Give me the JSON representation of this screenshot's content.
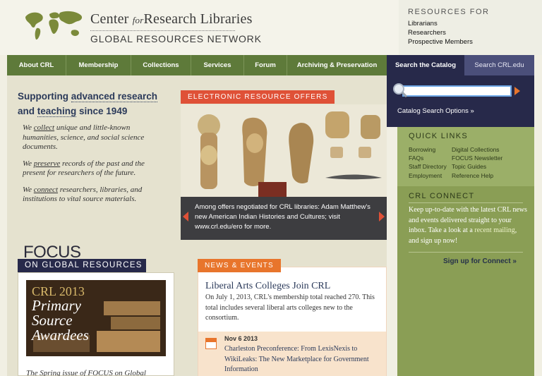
{
  "brand": {
    "name_part1": "Center ",
    "name_for": "for",
    "name_part2": "Research Libraries",
    "network": "GLOBAL RESOURCES NETWORK"
  },
  "resources_for": {
    "title": "RESOURCES FOR",
    "links": [
      "Librarians",
      "Researchers",
      "Prospective Members"
    ]
  },
  "nav": {
    "items": [
      "About CRL",
      "Membership",
      "Collections",
      "Services",
      "Forum",
      "Archiving & Preservation"
    ]
  },
  "catalog": {
    "tab_active": "Search the Catalog",
    "tab_alt": "Search CRL.edu",
    "options_link": "Catalog Search Options »",
    "search_value": ""
  },
  "tagline": {
    "pre": "Supporting ",
    "kw1": "advanced research",
    "mid": "and ",
    "kw2": "teaching",
    "post": " since 1949"
  },
  "statements": [
    {
      "pre": "We ",
      "kw": "collect",
      "post": " unique and little-known humanities, science, and social science documents."
    },
    {
      "pre": "We ",
      "kw": "preserve",
      "post": " records of the past and the present for researchers of the future."
    },
    {
      "pre": "We ",
      "kw": "connect",
      "post": " researchers, libraries, and institutions to vital source materials."
    }
  ],
  "ero": {
    "label": "ELECTRONIC RESOURCE OFFERS",
    "caption": "Among offers negotiated for CRL libraries: Adam Matthew's new American Indian Histories and Cultures; visit www.crl.edu/ero for more."
  },
  "focus": {
    "big": "FOCUS",
    "label": "ON GLOBAL RESOURCES",
    "image_year": "CRL 2013",
    "image_title": "Primary Source Awardees",
    "blurb": "The Spring issue of FOCUS on Global"
  },
  "news": {
    "label": "NEWS & EVENTS",
    "headline": "Liberal Arts Colleges Join CRL",
    "body": "On July 1, 2013, CRL's membership total reached 270. This total includes several liberal arts colleges new to the consortium.",
    "event_date": "Nov 6 2013",
    "event_title": "Charleston Preconference: From LexisNexis to WikiLeaks: The New Marketplace for Government Information"
  },
  "quick_links": {
    "title": "QUICK LINKS",
    "col1": [
      "Borrowing",
      "FAQs",
      "Staff Directory",
      "Employment"
    ],
    "col2": [
      "Digital Collections",
      "FOCUS Newsletter",
      "Topic Guides",
      "Reference Help"
    ]
  },
  "connect": {
    "title": "CRL CONNECT",
    "body_pre": "Keep up-to-date with the latest CRL news and events delivered straight to your inbox. Take a look at a ",
    "body_link": "recent mailing",
    "body_post": ", and sign up now!",
    "signup": "Sign up for Connect »"
  },
  "colors": {
    "nav_green": "#5e7a3a",
    "catalog_navy": "#27294a",
    "ero_red": "#df5137",
    "news_orange": "#e8752c",
    "right_green": "#8a9e55"
  }
}
